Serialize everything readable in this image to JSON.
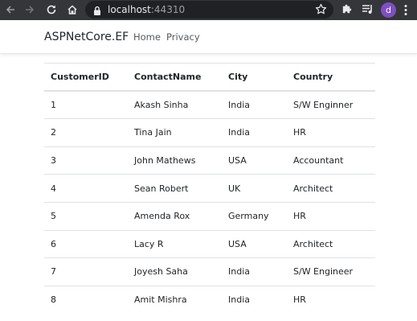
{
  "browser": {
    "url_host": "localhost",
    "url_port": ":44310",
    "profile_initial": "d"
  },
  "navbar": {
    "brand": "ASPNetCore.EF",
    "links": [
      "Home",
      "Privacy"
    ]
  },
  "table": {
    "headers": [
      "CustomerID",
      "ContactName",
      "City",
      "Country"
    ],
    "rows": [
      [
        "1",
        "Akash Sinha",
        "India",
        "S/W Enginner"
      ],
      [
        "2",
        "Tina Jain",
        "India",
        "HR"
      ],
      [
        "3",
        "John Mathews",
        "USA",
        "Accountant"
      ],
      [
        "4",
        "Sean Robert",
        "UK",
        "Architect"
      ],
      [
        "5",
        "Amenda Rox",
        "Germany",
        "HR"
      ],
      [
        "6",
        "Lacy R",
        "USA",
        "Architect"
      ],
      [
        "7",
        "Joyesh Saha",
        "India",
        "S/W Engineer"
      ],
      [
        "8",
        "Amit Mishra",
        "India",
        "HR"
      ]
    ]
  },
  "colors": {
    "chrome_bg": "#35363a",
    "omnibox_bg": "#202124",
    "profile_bg": "#7e4fc2",
    "table_border": "#dee2e6"
  },
  "icons": [
    "back-arrow-icon",
    "forward-arrow-icon",
    "reload-icon",
    "home-icon",
    "lock-icon",
    "star-icon",
    "puzzle-icon",
    "media-control-icon",
    "kebab-menu-icon"
  ]
}
